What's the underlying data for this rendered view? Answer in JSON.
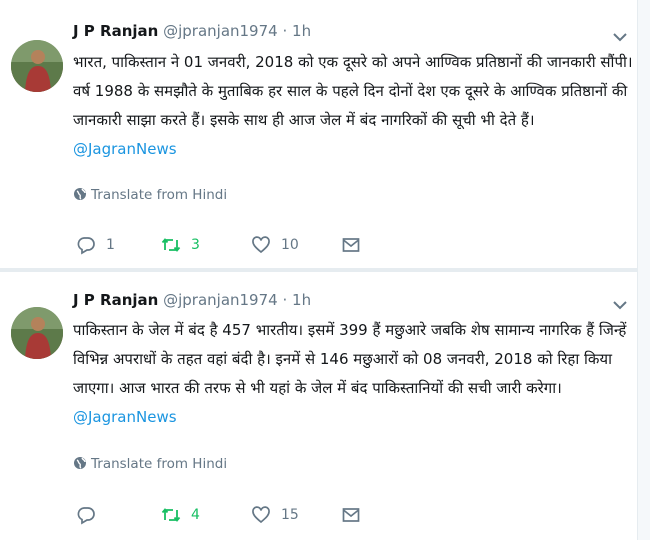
{
  "tweets": [
    {
      "name": "J P Ranjan",
      "handle": "@jpranjan1974",
      "separator": "·",
      "time": "1h",
      "text": "भारत, पाकिस्तान ने 01 जनवरी, 2018 को एक दूसरे को अपने आण्विक प्रतिष्ठानों की जानकारी सौंपी। वर्ष 1988 के समझौते के मुताबिक हर साल के पहले दिन दोनों देश एक दूसरे के आण्विक  प्रतिष्ठानों की जानकारी साझा करते हैं। इसके साथ ही आज जेल में बंद नागरिकों की सूची भी देते हैं।",
      "mention": "@JagranNews",
      "translate_label": "Translate from Hindi",
      "reply_count": "1",
      "retweet_count": "3",
      "like_count": "10",
      "icons": {
        "reply": "reply-icon",
        "retweet": "retweet-icon",
        "like": "heart-icon",
        "dm": "envelope-icon",
        "caret": "chevron-down-icon",
        "translate": "globe-icon"
      }
    },
    {
      "name": "J P Ranjan",
      "handle": "@jpranjan1974",
      "separator": "·",
      "time": "1h",
      "text": "पाकिस्तान के  जेल में बंद है 457 भारतीय। इसमें 399 हैं मछुआरे जबकि शेष सामान्य नागरिक हैं जिन्हें विभिन्न अपराधों के तहत वहां बंदी है। इनमें से 146 मछुआरों को 08 जनवरी, 2018 को रिहा किया जाएगा। आज भारत की तरफ से भी यहां के जेल में बंद पाकिस्तानियों की सची जारी करेगा।",
      "mention": "@JagranNews",
      "translate_label": "Translate from Hindi",
      "reply_count": "",
      "retweet_count": "4",
      "like_count": "15",
      "icons": {
        "reply": "reply-icon",
        "retweet": "retweet-icon",
        "like": "heart-icon",
        "dm": "envelope-icon",
        "caret": "chevron-down-icon",
        "translate": "globe-icon"
      }
    }
  ],
  "colors": {
    "link": "#1b95e0",
    "retweet_active": "#17bf63",
    "muted": "#657786",
    "text": "#14171a"
  }
}
